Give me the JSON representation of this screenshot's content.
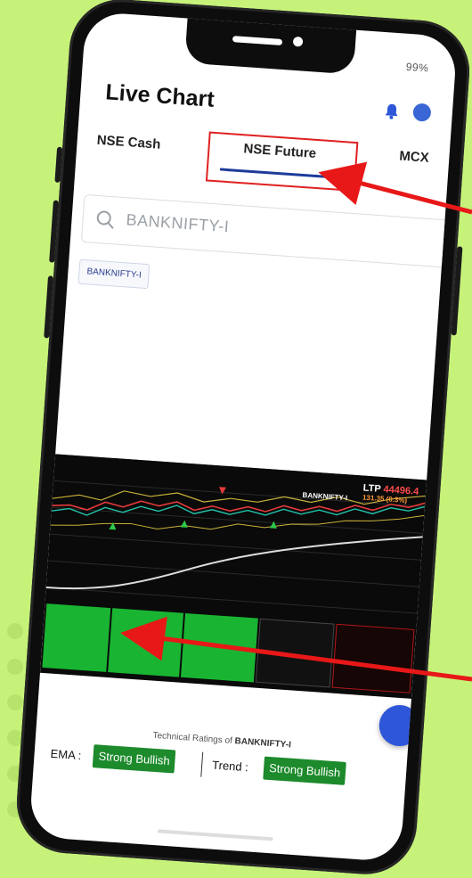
{
  "status_bar": {
    "right": "99%"
  },
  "header": {
    "title": "Live Chart"
  },
  "tabs": [
    {
      "label": "NSE Cash"
    },
    {
      "label": "NSE Future"
    },
    {
      "label": "MCX"
    }
  ],
  "search": {
    "placeholder": "BANKNIFTY-I"
  },
  "chip": {
    "label": "BANKNIFTY-I"
  },
  "chart": {
    "symbol": "BANKNIFTY-I",
    "ltp_label": "LTP",
    "ltp_value": "44496.4",
    "change": "131.35 (0.3%)"
  },
  "ratings": {
    "caption_prefix": "Technical Ratings of",
    "caption_symbol": "BANKNIFTY-I",
    "ema_label": "EMA :",
    "ema_value": "Strong Bullish",
    "trend_label": "Trend :",
    "trend_value": "Strong Bullish"
  },
  "colors": {
    "background": "#c6f27a",
    "highlight_box": "#e02020",
    "tab_underline": "#1d3c9a",
    "bullish": "#1d8a2c",
    "arrow": "#e81818"
  }
}
